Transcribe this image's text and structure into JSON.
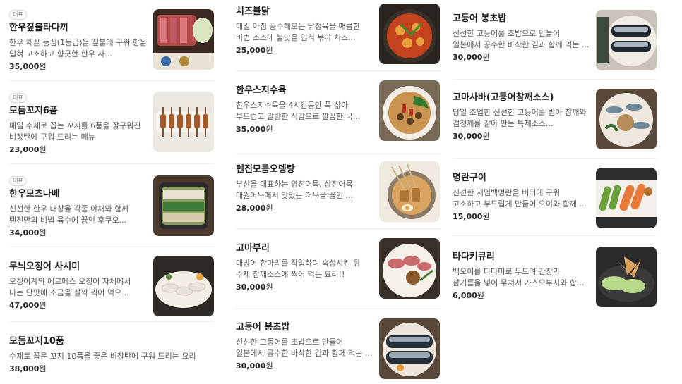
{
  "badge_label": "대표",
  "currency_suffix": "원",
  "columns": [
    [
      {
        "name": "한우짚불타다끼",
        "desc": "한우 채끝 등심(1등급)을 짚불에 구워 향을 입혀 고소하고 향긋한 한우 사...",
        "price": "35,000",
        "badge": true
      },
      {
        "name": "모듬꼬지6품",
        "desc": "매일 수제로 꼽는 꼬지를 6품을 잘구워진 비장탄에 구워 드리는 메뉴",
        "price": "23,000",
        "badge": true
      },
      {
        "name": "한우모츠나베",
        "desc": "신선한 한우 대창을 각종 야채와 함께 텐진만의 비법 육수에 끓인 후쿠오...",
        "price": "34,000",
        "badge": true
      },
      {
        "name": "무늬오징어 사시미",
        "desc": "오징어계의 에르메스 오징어 자체에서 나는 단맛에 소금을 살짝 찍어 먹으...",
        "price": "47,000",
        "badge": false
      },
      {
        "name": "모듬꼬지10품",
        "desc": "수제로 꼽은 꼬지 10품을 좋은 비장탄에 구워 드리는 요리",
        "price": "38,000",
        "badge": false
      }
    ],
    [
      {
        "name": "치즈불닭",
        "desc": "매일 아침 공수해오는 닭정육을 매콤한 비법 소스에 불맛을 입혀 볶아 치즈...",
        "price": "25,000",
        "badge": false
      },
      {
        "name": "한우스지수육",
        "desc": "한우스지수육을 4시간동안 푹 삶아 부드럽고 말랑한 식감으로 깔끔한 국...",
        "price": "35,000",
        "badge": false
      },
      {
        "name": "텐진모듬오뎅탕",
        "desc": "부산을 대표하는 영진어묵, 삼진어묵, 대원어묵에서 맛있는 어묵을 끓인 ...",
        "price": "28,000",
        "badge": false
      },
      {
        "name": "고마부리",
        "desc": "대방어 한마리를 작업하여 숙성시킨 뒤 수제 참깨소스에 찍어 먹는 요리!!",
        "price": "30,000",
        "badge": false
      },
      {
        "name": "고등어 봉초밥",
        "desc": "신선한 고등어를 초밥으로 만들어 일본에서 공수한 바삭한 김과 함께 먹는 ...",
        "price": "30,000",
        "badge": false
      }
    ],
    [
      {
        "name": "고등어 봉초밥",
        "desc": "신선한 고등어를 초밥으로 만들어 일본에서 공수한 바삭한 김과 함께 먹는 ...",
        "price": "30,000",
        "badge": false
      },
      {
        "name": "고마사바(고등어참깨소스)",
        "desc": "당일 조업한 신선한 고등어를 받아 참깨와 검정깨를 갈아 만든 특제소스...",
        "price": "30,000",
        "badge": false
      },
      {
        "name": "명란구이",
        "desc": "신선한 저염백명란을 버터에 구워 고소하고 부드럽게 만들어 오이와 함께 ...",
        "price": "15,000",
        "badge": false
      },
      {
        "name": "타다키큐리",
        "desc": "백오이를 다다미로 두드려 간장과 참기름을 넣어 무쳐서 가스오부시와 함...",
        "price": "6,000",
        "badge": false
      }
    ]
  ]
}
